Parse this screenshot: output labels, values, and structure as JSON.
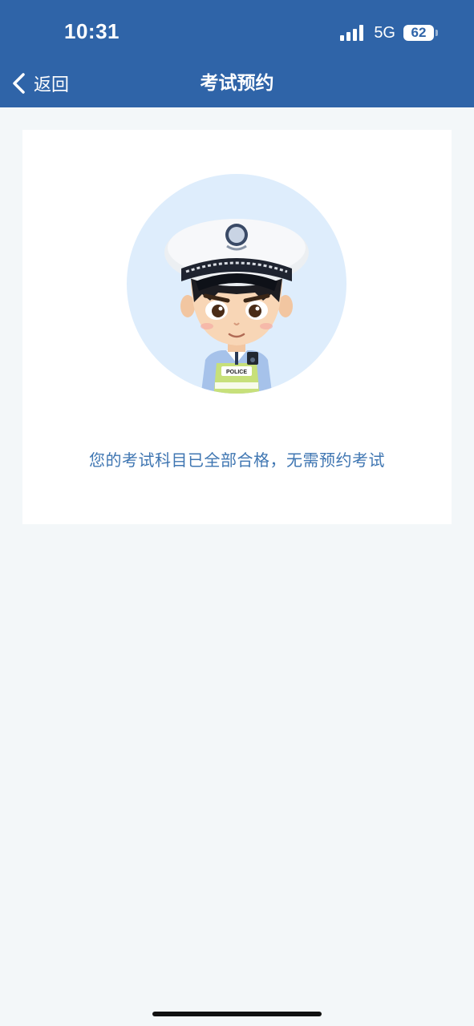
{
  "status_bar": {
    "time": "10:31",
    "network": "5G",
    "battery": "62"
  },
  "nav": {
    "back_label": "返回",
    "title": "考试预约",
    "color": "#2f64a8"
  },
  "main": {
    "avatar_label": "POLICE",
    "message": "您的考试科目已全部合格，无需预约考试",
    "message_color": "#3f76b2"
  },
  "icons": [
    "signal-icon",
    "battery-icon",
    "back-arrow-icon",
    "police-avatar"
  ]
}
